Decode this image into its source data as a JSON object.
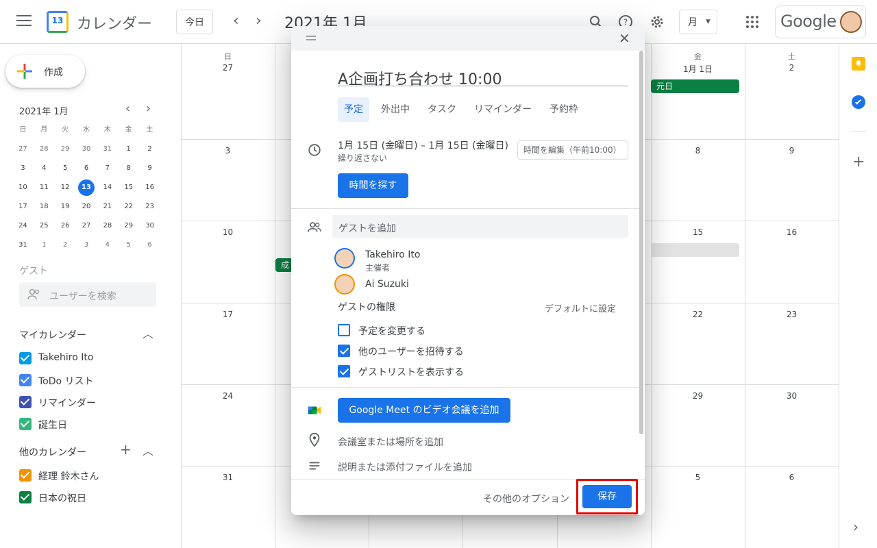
{
  "header": {
    "app_name": "カレンダー",
    "logo_day": "13",
    "today_button": "今日",
    "current_month": "2021年 1月",
    "view_select": "月",
    "brand": "Google"
  },
  "sidebar": {
    "create_label": "作成",
    "mini_month": "2021年 1月",
    "weekday_headers": [
      "日",
      "月",
      "火",
      "水",
      "木",
      "金",
      "土"
    ],
    "mini_weeks": [
      [
        "27",
        "28",
        "29",
        "30",
        "31",
        "1",
        "2"
      ],
      [
        "3",
        "4",
        "5",
        "6",
        "7",
        "8",
        "9"
      ],
      [
        "10",
        "11",
        "12",
        "13",
        "14",
        "15",
        "16"
      ],
      [
        "17",
        "18",
        "19",
        "20",
        "21",
        "22",
        "23"
      ],
      [
        "24",
        "25",
        "26",
        "27",
        "28",
        "29",
        "30"
      ],
      [
        "31",
        "1",
        "2",
        "3",
        "4",
        "5",
        "6"
      ]
    ],
    "today": "13",
    "guest_section": "ゲスト",
    "guest_search_placeholder": "ユーザーを検索",
    "my_calendars_title": "マイカレンダー",
    "my_calendars": [
      {
        "label": "Takehiro Ito",
        "color": "#039be5"
      },
      {
        "label": "ToDo リスト",
        "color": "#4285f4"
      },
      {
        "label": "リマインダー",
        "color": "#3f51b5"
      },
      {
        "label": "誕生日",
        "color": "#33b679"
      }
    ],
    "other_calendars_title": "他のカレンダー",
    "other_calendars": [
      {
        "label": "経理 鈴木さん",
        "color": "#f09300"
      },
      {
        "label": "日本の祝日",
        "color": "#0b8043"
      }
    ]
  },
  "grid": {
    "weekday_headers": [
      "日",
      "",
      "",
      "",
      "",
      "金",
      "土"
    ],
    "first_row_dates": [
      "27",
      "",
      "",
      "",
      "",
      "1月 1日",
      "2"
    ],
    "rows": [
      [
        "3",
        "",
        "",
        "",
        "",
        "8",
        "9"
      ],
      [
        "10",
        "",
        "",
        "",
        "",
        "15",
        "16"
      ],
      [
        "17",
        "",
        "",
        "",
        "",
        "22",
        "23"
      ],
      [
        "24",
        "",
        "",
        "",
        "",
        "29",
        "30"
      ],
      [
        "31",
        "",
        "",
        "",
        "",
        "5",
        "6"
      ]
    ],
    "events": [
      {
        "label": "元日",
        "color": "#0b8043"
      },
      {
        "label": "成",
        "color": "#0b8043"
      }
    ]
  },
  "dialog": {
    "title": "A企画打ち合わせ 10:00",
    "tabs": [
      "予定",
      "外出中",
      "タスク",
      "リマインダー",
      "予約枠"
    ],
    "active_tab": "予定",
    "date_range": "1月 15日 (金曜日)  –  1月 15日 (金曜日)",
    "repeat": "繰り返さない",
    "time_edit": "時間を編集（午前10:00）",
    "find_time": "時間を探す",
    "guest_placeholder": "ゲストを追加",
    "guests": [
      {
        "name": "Takehiro Ito",
        "role": "主催者"
      },
      {
        "name": "Ai Suzuki",
        "role": ""
      }
    ],
    "permissions_title": "ゲストの権限",
    "permissions_default": "デフォルトに設定",
    "permissions": [
      {
        "label": "予定を変更する",
        "checked": false
      },
      {
        "label": "他のユーザーを招待する",
        "checked": true
      },
      {
        "label": "ゲストリストを表示する",
        "checked": true
      }
    ],
    "meet_button": "Google Meet のビデオ会議を追加",
    "location_placeholder": "会議室または場所を追加",
    "description_placeholder": "説明または添付ファイルを追加",
    "more_options": "その他のオプション",
    "save": "保存"
  }
}
